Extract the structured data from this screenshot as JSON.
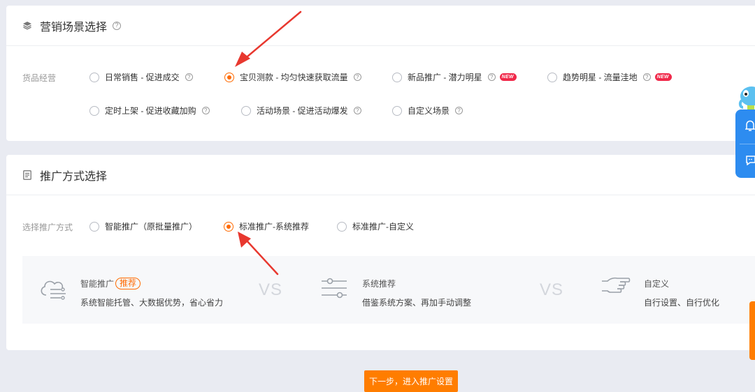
{
  "scene_section": {
    "title": "营销场景选择",
    "row_label": "货品经营",
    "options": [
      {
        "label": "日常销售 - 促进成交",
        "selected": false,
        "new": false
      },
      {
        "label": "宝贝测款 - 均匀快速获取流量",
        "selected": true,
        "new": false
      },
      {
        "label": "新品推广 - 潜力明星",
        "selected": false,
        "new": true
      },
      {
        "label": "趋势明星 - 流量洼地",
        "selected": false,
        "new": true
      },
      {
        "label": "定时上架 - 促进收藏加购",
        "selected": false,
        "new": false
      },
      {
        "label": "活动场景 - 促进活动爆发",
        "selected": false,
        "new": false
      },
      {
        "label": "自定义场景",
        "selected": false,
        "new": false
      }
    ],
    "new_badge": "NEW"
  },
  "method_section": {
    "title": "推广方式选择",
    "row_label": "选择推广方式",
    "options": [
      {
        "label": "智能推广（原批量推广）",
        "selected": false
      },
      {
        "label": "标准推广-系统推荐",
        "selected": true
      },
      {
        "label": "标准推广-自定义",
        "selected": false
      }
    ],
    "compare": [
      {
        "title": "智能推广",
        "tag": "推荐",
        "desc": "系统智能托管、大数据优势，省心省力",
        "icon": "cloud-flow-icon"
      },
      {
        "title": "系统推荐",
        "desc": "借鉴系统方案、再加手动调整",
        "icon": "sliders-icon"
      },
      {
        "title": "自定义",
        "desc": "自行设置、自行优化",
        "icon": "hand-pointing-icon"
      }
    ],
    "vs_label": "VS"
  },
  "next_button": "下一步，进入推广设置",
  "colors": {
    "accent": "#ff6a00",
    "button": "#ff7d00",
    "new_badge": "#f0294a",
    "annotation_arrow": "#e8382f",
    "float_panel": "#2d8cf0"
  }
}
